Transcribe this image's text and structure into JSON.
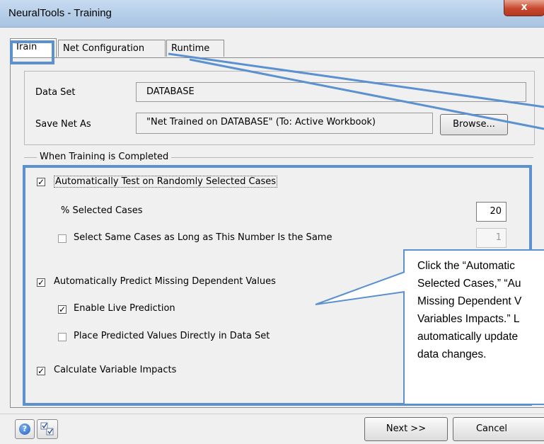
{
  "window": {
    "title": "NeuralTools - Training",
    "close_glyph": "x"
  },
  "tabs": [
    {
      "label": "Train",
      "selected": true
    },
    {
      "label": "Net Configuration",
      "selected": false
    },
    {
      "label": "Runtime",
      "selected": false
    }
  ],
  "data_set": {
    "label": "Data Set",
    "value": "DATABASE"
  },
  "save_net": {
    "label": "Save Net As",
    "value": "\"Net Trained on DATABASE\" (To: Active Workbook)",
    "browse_label": "Browse..."
  },
  "training_completed": {
    "group_label": "When Training is Completed",
    "auto_test": {
      "label": "Automatically Test on Randomly Selected Cases",
      "checked": true
    },
    "pct_selected": {
      "label": "% Selected Cases",
      "value": "20"
    },
    "same_cases": {
      "label": "Select Same Cases as Long as This Number Is the Same",
      "checked": false,
      "value": "1"
    },
    "auto_predict": {
      "label": "Automatically Predict Missing Dependent Values",
      "checked": true
    },
    "live_prediction": {
      "label": "Enable Live Prediction",
      "checked": true
    },
    "place_predicted": {
      "label": "Place Predicted Values Directly in Data Set",
      "checked": false
    },
    "variable_impacts": {
      "label": "Calculate Variable Impacts",
      "checked": true
    }
  },
  "callout": {
    "lines": [
      "Click the “Automatic",
      "Selected Cases,” “Au",
      "Missing Dependent V",
      "Variables Impacts.” L",
      "automatically update",
      "data changes."
    ]
  },
  "footer": {
    "next_label": "Next >>",
    "cancel_label": "Cancel",
    "help_glyph": "?"
  },
  "colors": {
    "highlight": "#5b91cf",
    "titlebar": "#b4cde8",
    "close_button": "#c8472d"
  },
  "icons": [
    "close-icon",
    "help-icon",
    "check-icon"
  ]
}
